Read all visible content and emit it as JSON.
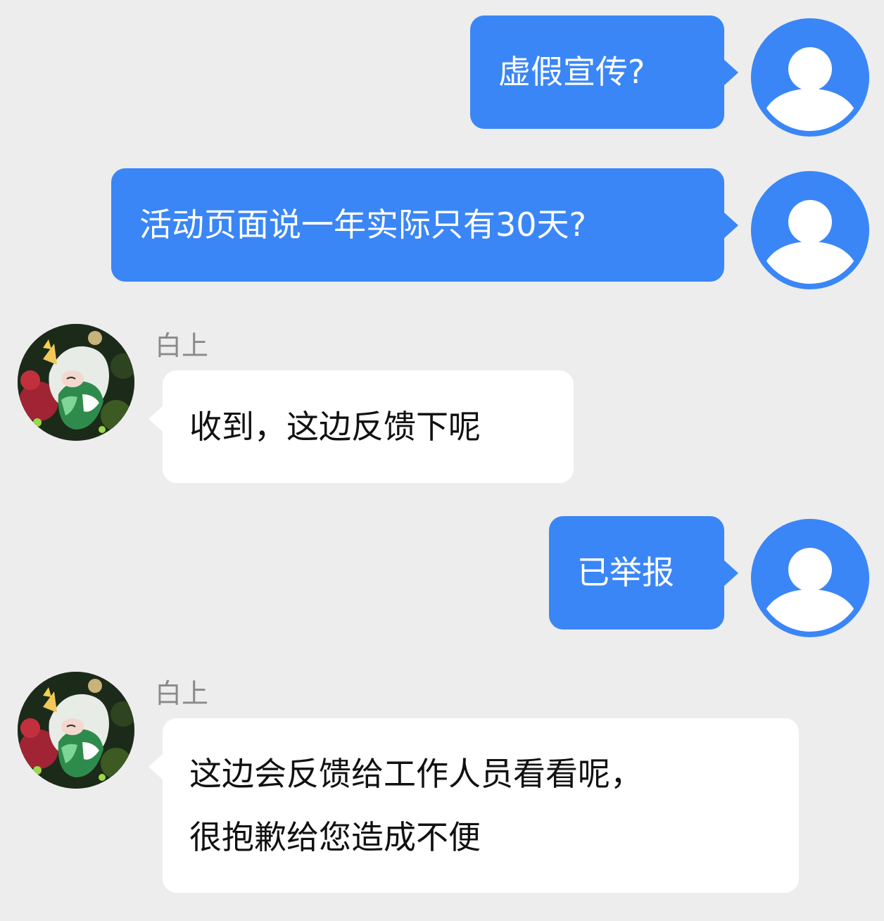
{
  "messages": [
    {
      "direction": "out",
      "text": "虚假宣传?"
    },
    {
      "direction": "out",
      "text": "活动页面说一年实际只有30天?"
    },
    {
      "direction": "in",
      "sender": "白上",
      "text": "收到，这边反馈下呢"
    },
    {
      "direction": "out",
      "text": "已举报"
    },
    {
      "direction": "in",
      "sender": "白上",
      "lines": [
        "这边会反馈给工作人员看看呢，",
        "很抱歉给您造成不便"
      ]
    }
  ],
  "icons": {
    "user_avatar": "default-user-icon",
    "bot_avatar": "character-avatar"
  },
  "colors": {
    "background": "#ededed",
    "outgoing_bubble": "#3a86f6",
    "incoming_bubble": "#ffffff",
    "sender_name": "#8a8a8a"
  }
}
